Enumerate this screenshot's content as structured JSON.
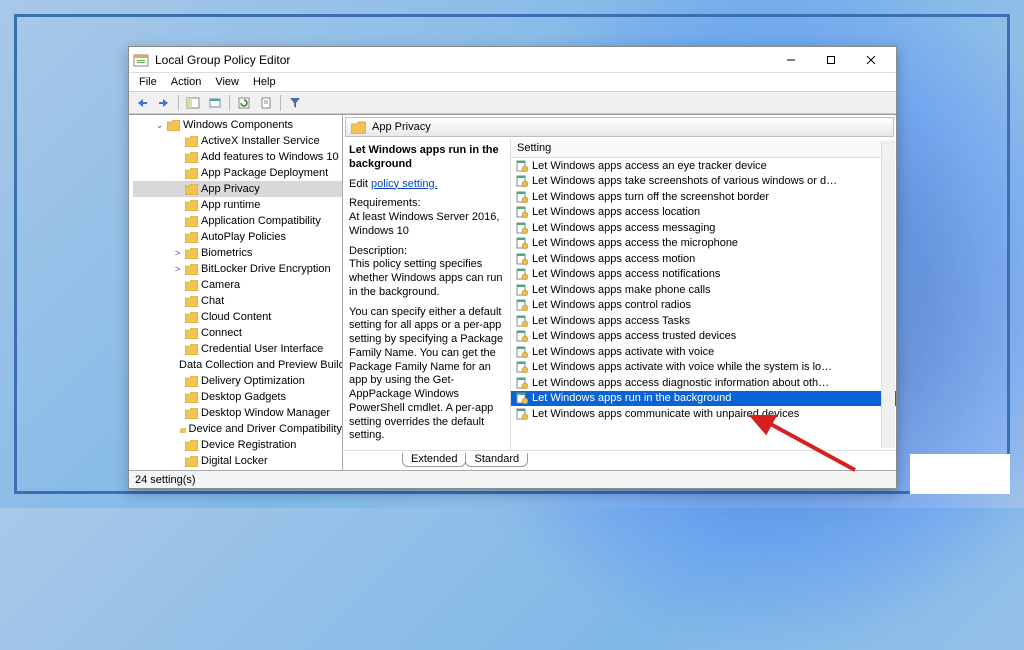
{
  "window": {
    "title": "Local Group Policy Editor"
  },
  "menubar": [
    "File",
    "Action",
    "View",
    "Help"
  ],
  "tree": {
    "root": "Windows Components",
    "items": [
      "ActiveX Installer Service",
      "Add features to Windows 10",
      "App Package Deployment",
      "App Privacy",
      "App runtime",
      "Application Compatibility",
      "AutoPlay Policies",
      "Biometrics",
      "BitLocker Drive Encryption",
      "Camera",
      "Chat",
      "Cloud Content",
      "Connect",
      "Credential User Interface",
      "Data Collection and Preview Builc",
      "Delivery Optimization",
      "Desktop Gadgets",
      "Desktop Window Manager",
      "Device and Driver Compatibility",
      "Device Registration",
      "Digital Locker"
    ],
    "selected_index": 3,
    "expandable": [
      7,
      8
    ]
  },
  "category": {
    "title": "App Privacy"
  },
  "description": {
    "heading": "Let Windows apps run in the background",
    "edit_prefix": "Edit ",
    "edit_link": "policy setting.",
    "req_label": "Requirements:",
    "req_text": "At least Windows Server 2016, Windows 10",
    "desc_label": "Description:",
    "desc_text": "This policy setting specifies whether Windows apps can run in the background.",
    "detail_text": "You can specify either a default setting for all apps or a per-app setting by specifying a Package Family Name. You can get the Package Family Name for an app by using the Get-AppPackage Windows PowerShell cmdlet. A per-app setting overrides the default setting."
  },
  "list": {
    "header": "Setting",
    "items": [
      "Let Windows apps access an eye tracker device",
      "Let Windows apps take screenshots of various windows or d…",
      "Let Windows apps turn off the screenshot border",
      "Let Windows apps access location",
      "Let Windows apps access messaging",
      "Let Windows apps access the microphone",
      "Let Windows apps access motion",
      "Let Windows apps access notifications",
      "Let Windows apps make phone calls",
      "Let Windows apps control radios",
      "Let Windows apps access Tasks",
      "Let Windows apps access trusted devices",
      "Let Windows apps activate with voice",
      "Let Windows apps activate with voice while the system is lo…",
      "Let Windows apps access diagnostic information about oth…",
      "Let Windows apps run in the background",
      "Let Windows apps communicate with unpaired devices"
    ],
    "selected_index": 15
  },
  "tabs": [
    "Extended",
    "Standard"
  ],
  "active_tab": 1,
  "statusbar": "24 setting(s)"
}
